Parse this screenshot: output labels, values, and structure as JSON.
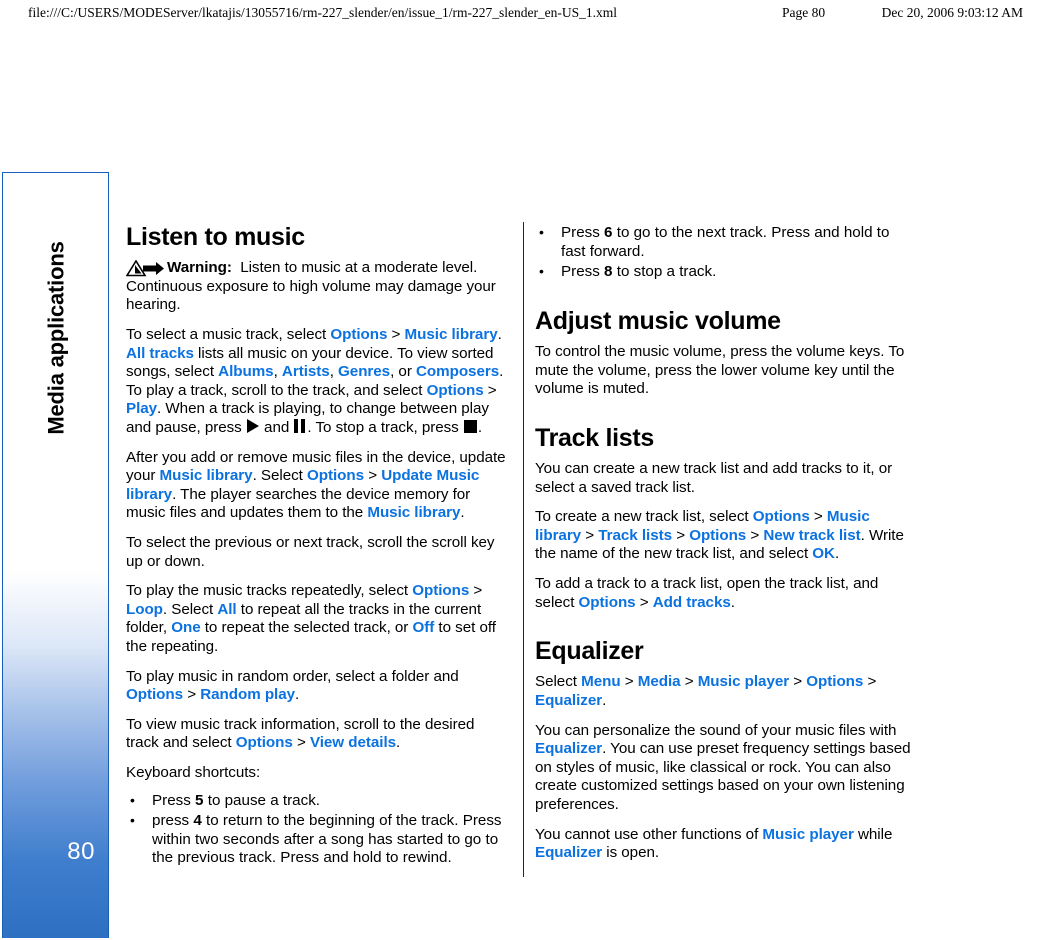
{
  "print_header": {
    "url": "file:///C:/USERS/MODEServer/lkatajis/13055716/rm-227_slender/en/issue_1/rm-227_slender_en-US_1.xml",
    "page": "Page 80",
    "date": "Dec 20, 2006 9:03:12 AM"
  },
  "side_tab": {
    "chapter_label": "Media applications",
    "page_number": "80",
    "gradient_top_color": "#ffffff",
    "gradient_bottom_color": "#2e6fc2",
    "border_color": "#1560bd"
  },
  "colors": {
    "link_blue": "#0b72e0",
    "body_text": "#000000"
  },
  "left_column": {
    "heading": "Listen to music",
    "warning": {
      "icon": "warning-triangle-arrow-icon",
      "label": "Warning:",
      "text": "Listen to music at a moderate level. Continuous exposure to high volume may damage your hearing."
    },
    "para_select_track": {
      "t1": "To select a music track, select ",
      "k1": "Options",
      "s1": ">",
      "k2": "Music library",
      "t2": ". ",
      "k3": "All tracks",
      "t3": " lists all music on your device. To view sorted songs, select ",
      "k4": "Albums",
      "t4": ", ",
      "k5": "Artists",
      "t5": ", ",
      "k6": "Genres",
      "t6": ", or ",
      "k7": "Composers",
      "t7": ". To play a track, scroll to the track, and select ",
      "k8": "Options",
      "s2": ">",
      "k9": "Play",
      "t8": ". When a track is playing, to change between play and pause, press ",
      "t9": " and ",
      "t10": ". To stop a track, press ",
      "t11": "."
    },
    "para_update": {
      "t1": "After you add or remove music files in the device, update your ",
      "k1": "Music library",
      "t2": ". Select ",
      "k2": "Options",
      "s1": ">",
      "k3": "Update Music library",
      "t3": ". The player searches the device memory for music files and updates them to the ",
      "k4": "Music library",
      "t4": "."
    },
    "para_prev_next": "To select the previous or next track, scroll the scroll key up or down.",
    "para_loop": {
      "t1": "To play the music tracks repeatedly, select ",
      "k1": "Options",
      "s1": ">",
      "k2": "Loop",
      "t2": ". Select ",
      "k3": "All",
      "t3": " to repeat all the tracks in the current folder, ",
      "k4": "One",
      "t4": " to repeat the selected track, or ",
      "k5": "Off",
      "t5": " to set off the repeating."
    },
    "para_random": {
      "t1": "To play music in random order, select a folder and ",
      "k1": "Options",
      "s1": ">",
      "k2": "Random play",
      "t2": "."
    },
    "para_view_details": {
      "t1": "To view music track information, scroll to the desired track and select ",
      "k1": "Options",
      "s1": ">",
      "k2": "View details",
      "t2": "."
    },
    "shortcuts_label": "Keyboard shortcuts:",
    "shortcuts": [
      {
        "pre": "Press ",
        "key": "5",
        "post": " to pause a track."
      },
      {
        "pre": "press ",
        "key": "4",
        "post": " to return to the beginning of the track. Press within two seconds after a song has started to go to the previous track. Press and hold to rewind."
      }
    ]
  },
  "right_column": {
    "shortcuts": [
      {
        "pre": "Press ",
        "key": "6",
        "post": " to go to the next track. Press and hold to fast forward."
      },
      {
        "pre": "Press ",
        "key": "8",
        "post": " to stop a track."
      }
    ],
    "adjust_volume": {
      "heading": "Adjust music volume",
      "para": "To control the music volume, press the volume keys. To mute the volume, press the lower volume key until the volume is muted."
    },
    "track_lists": {
      "heading": "Track lists",
      "para1": "You can create a new track list and add tracks to it, or select a saved track list.",
      "para2": {
        "t1": "To create a new track list, select ",
        "k1": "Options",
        "s1": ">",
        "k2": "Music library",
        "s2": ">",
        "k3": "Track lists",
        "s3": ">",
        "k4": "Options",
        "s4": ">",
        "k5": "New track list",
        "t2": ". Write the name of the new track list, and select ",
        "k6": "OK",
        "t3": "."
      },
      "para3": {
        "t1": "To add a track to a track list, open the track list, and select ",
        "k1": "Options",
        "s1": ">",
        "k2": "Add tracks",
        "t2": "."
      }
    },
    "equalizer": {
      "heading": "Equalizer",
      "para1": {
        "t1": "Select ",
        "k1": "Menu",
        "s1": ">",
        "k2": "Media",
        "s2": ">",
        "k3": "Music player",
        "s3": ">",
        "k4": "Options",
        "s4": ">",
        "k5": "Equalizer",
        "t2": "."
      },
      "para2": {
        "t1": "You can personalize the sound of your music files with ",
        "k1": "Equalizer",
        "t2": ". You can use preset frequency settings based on styles of music, like classical or rock. You can also create customized settings based on your own listening preferences."
      },
      "para3": {
        "t1": "You cannot use other functions of ",
        "k1": "Music player",
        "t2": " while ",
        "k2": "Equalizer",
        "t3": " is open."
      }
    }
  }
}
